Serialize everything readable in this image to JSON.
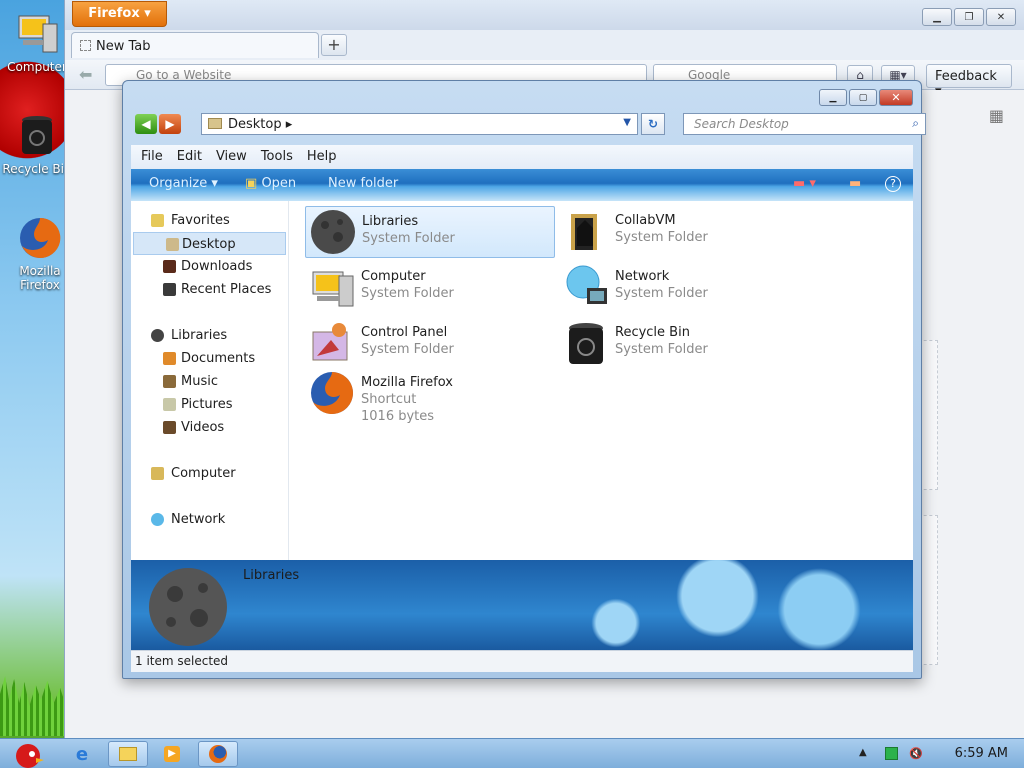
{
  "desktop": {
    "icons": [
      {
        "label": "Computer"
      },
      {
        "label": "Recycle Bin"
      },
      {
        "label": "Mozilla Firefox"
      }
    ]
  },
  "firefox": {
    "menu_button": "Firefox",
    "tab_title": "New Tab",
    "url_placeholder": "Go to a Website",
    "search_engine": "Google",
    "feedback_label": "Feedback"
  },
  "explorer": {
    "address": "Desktop",
    "search_placeholder": "Search Desktop",
    "menu": [
      "File",
      "Edit",
      "View",
      "Tools",
      "Help"
    ],
    "toolbar": {
      "organize": "Organize",
      "open": "Open",
      "new_folder": "New folder"
    },
    "nav": {
      "favorites": "Favorites",
      "desktop": "Desktop",
      "downloads": "Downloads",
      "recent_places": "Recent Places",
      "libraries": "Libraries",
      "documents": "Documents",
      "music": "Music",
      "pictures": "Pictures",
      "videos": "Videos",
      "computer": "Computer",
      "network": "Network"
    },
    "files": [
      {
        "name": "Libraries",
        "type": "System Folder"
      },
      {
        "name": "CollabVM",
        "type": "System Folder"
      },
      {
        "name": "Computer",
        "type": "System Folder"
      },
      {
        "name": "Network",
        "type": "System Folder"
      },
      {
        "name": "Control Panel",
        "type": "System Folder"
      },
      {
        "name": "Recycle Bin",
        "type": "System Folder"
      },
      {
        "name": "Mozilla Firefox",
        "type": "Shortcut",
        "size": "1016 bytes"
      }
    ],
    "details_name": "Libraries",
    "status": "1 item selected"
  },
  "taskbar": {
    "clock": "6:59 AM"
  },
  "colors": {
    "accent": "#1f6fbf",
    "firefox_orange": "#e2700a",
    "selection": "#d6e7f8"
  }
}
